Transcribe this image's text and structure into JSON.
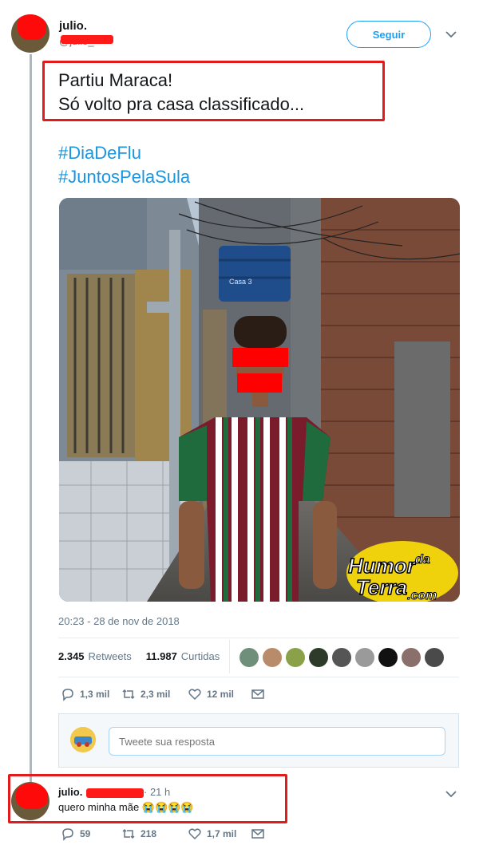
{
  "tweet": {
    "author_name": "julio.",
    "handle": "@julio_",
    "follow_label": "Seguir",
    "text_lines": [
      "Partiu Maraca!",
      "Só volto pra casa classificado..."
    ],
    "hashtags": [
      "#DiaDeFlu",
      "#JuntosPelaSula"
    ],
    "timestamp": "20:23 - 28 de nov de 2018",
    "retweets_count": "2.345",
    "retweets_label": "Retweets",
    "likes_count": "11.987",
    "likes_label": "Curtidas",
    "actions": {
      "replies": "1,3 mil",
      "retweets": "2,3 mil",
      "likes": "12 mil"
    },
    "photo": {
      "watermark_line1": "Humor",
      "watermark_da": "da",
      "watermark_line2": "Terra",
      "watermark_com": ".com",
      "sign_text": "Casa 3"
    }
  },
  "reply_composer": {
    "placeholder": "Tweete sua resposta"
  },
  "reply": {
    "author_name": "julio.",
    "time": "· 21 h",
    "text": "quero minha mãe 😭😭😭😭",
    "actions": {
      "replies": "59",
      "retweets": "218",
      "likes": "1,7 mil"
    }
  },
  "colors": {
    "brand": "#1da1f2",
    "link": "#1b95e0",
    "redaction": "#ff1a1a",
    "highlight_border": "#e21c1c"
  },
  "icons": [
    "chevron-down-icon",
    "reply-icon",
    "retweet-icon",
    "like-icon",
    "mail-icon"
  ]
}
